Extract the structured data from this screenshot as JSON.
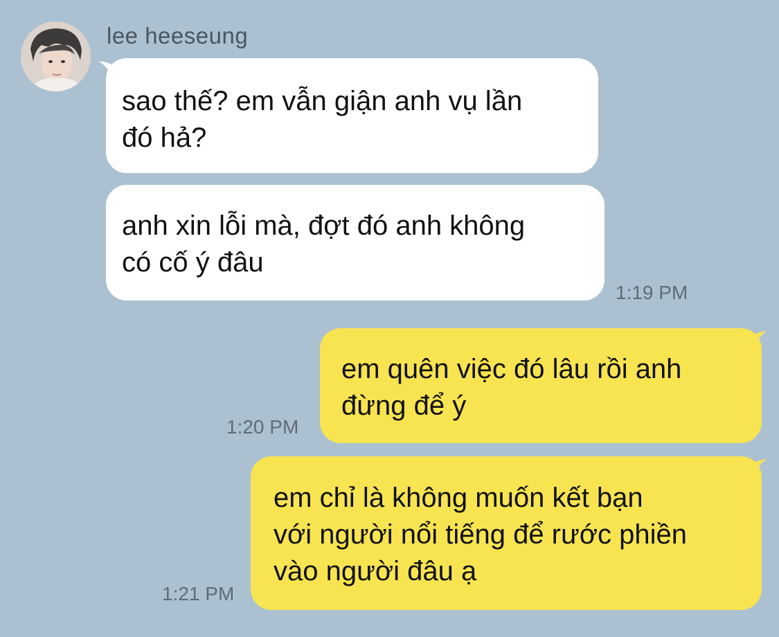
{
  "contact": {
    "name": "lee heeseung"
  },
  "colors": {
    "background": "#abc1d1",
    "incoming_bubble": "#ffffff",
    "outgoing_bubble": "#f8e451",
    "timestamp": "#5f6c77"
  },
  "messages": [
    {
      "direction": "incoming",
      "text": "sao thế? em vẫn giận anh vụ lần\nđó hả?",
      "time": ""
    },
    {
      "direction": "incoming",
      "text": "anh xin lỗi mà, đợt đó anh không\ncó cố ý đâu",
      "time": "1:19 PM"
    },
    {
      "direction": "outgoing",
      "text": "em quên việc đó lâu rồi anh\nđừng để ý",
      "time": "1:20 PM"
    },
    {
      "direction": "outgoing",
      "text": "em chỉ là không muốn kết bạn\nvới người nổi tiếng để rước phiền\nvào người đâu ạ",
      "time": "1:21 PM"
    }
  ]
}
